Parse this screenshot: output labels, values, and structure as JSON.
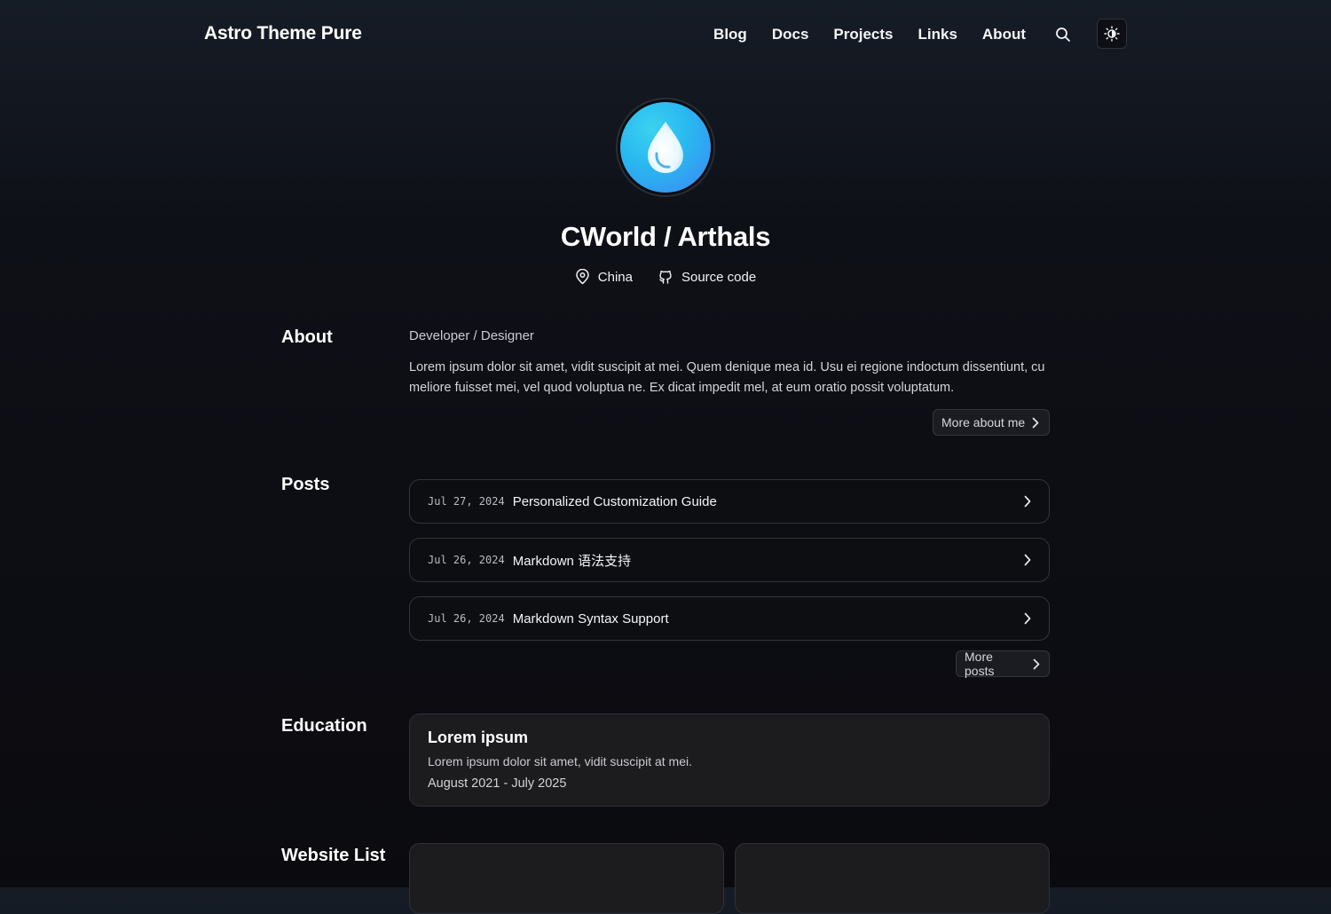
{
  "header": {
    "brand": "Astro Theme Pure",
    "nav": [
      "Blog",
      "Docs",
      "Projects",
      "Links",
      "About"
    ],
    "search_icon": "search-icon",
    "theme_icon": "sun-moon-icon"
  },
  "hero": {
    "title": "CWorld / Arthals",
    "location": "China",
    "location_icon": "location-pin-icon",
    "source": "Source code",
    "source_icon": "github-icon",
    "avatar_color_start": "#3ad2ef",
    "avatar_color_end": "#3d86f5"
  },
  "about": {
    "label": "About",
    "role": "Developer / Designer",
    "body": "Lorem ipsum dolor sit amet, vidit suscipit at mei. Quem denique mea id. Usu ei regione indoctum dissentiunt, cu meliore fuisset mei, vel quod voluptua ne. Ex dicat impedit mel, at eum oratio possit voluptatum.",
    "more_label": "More about me"
  },
  "posts": {
    "label": "Posts",
    "items": [
      {
        "date": "Jul 27, 2024",
        "title": "Personalized Customization Guide"
      },
      {
        "date": "Jul 26, 2024",
        "title": "Markdown 语法支持"
      },
      {
        "date": "Jul 26, 2024",
        "title": "Markdown Syntax Support"
      }
    ],
    "more_label": "More posts"
  },
  "education": {
    "label": "Education",
    "title": "Lorem ipsum",
    "description": "Lorem ipsum dolor sit amet, vidit suscipit at mei.",
    "dates": "August 2021 - July 2025"
  },
  "websites": {
    "label": "Website List"
  },
  "colors": {
    "background": "#0b0b0f",
    "card": "#1c1c1f",
    "border": "#31343b",
    "text": "#f2f3f5"
  }
}
